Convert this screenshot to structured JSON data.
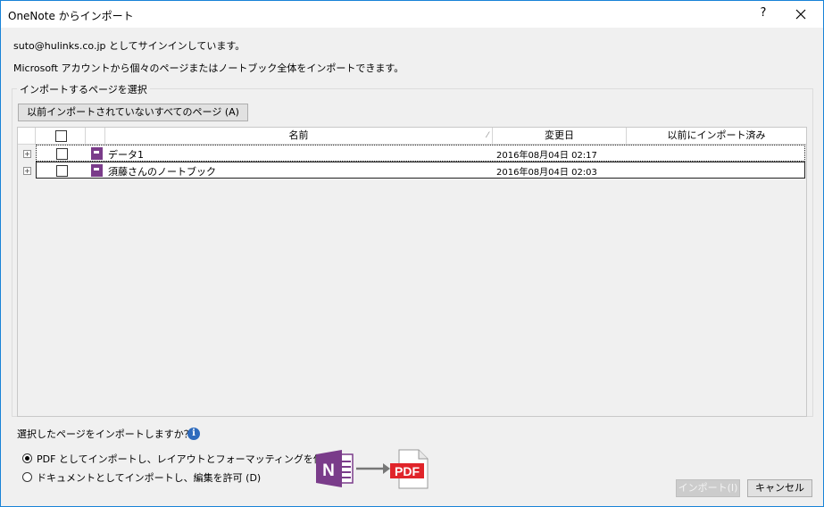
{
  "window": {
    "title": "OneNote からインポート",
    "help_label": "?",
    "close_icon": "close-icon"
  },
  "info": {
    "signed_in": "suto@hulinks.co.jp としてサインインしています。",
    "description": "Microsoft アカウントから個々のページまたはノートブック全体をインポートできます。"
  },
  "selection": {
    "group_label": "インポートするページを選択",
    "all_button": "以前インポートされていないすべてのページ (A)",
    "table": {
      "columns": [
        "名前",
        "変更日",
        "以前にインポート済み"
      ],
      "sort_indicator": "⁄",
      "rows": [
        {
          "name": "データ1",
          "modified": "2016年08月04日  02:17",
          "imported": "",
          "checked": false
        },
        {
          "name": "須藤さんのノートブック",
          "modified": "2016年08月04日  02:03",
          "imported": "",
          "checked": false
        }
      ]
    }
  },
  "import_options": {
    "question": "選択したページをインポートしますか？",
    "info_icon": "info-icon",
    "info_glyph": "i",
    "options": [
      {
        "label": "PDF としてインポートし、レイアウトとフォーマッティングを保持 (P)",
        "selected": true
      },
      {
        "label": "ドキュメントとしてインポートし、編集を許可 (D)",
        "selected": false
      }
    ],
    "illustration": {
      "onenote_letter": "N",
      "pdf_label": "PDF"
    }
  },
  "buttons": {
    "import": "インポート(I)",
    "cancel": "キャンセル"
  },
  "colors": {
    "accent": "#1883d7",
    "onenote_purple": "#7a3c8a",
    "pdf_red": "#e0242a"
  }
}
